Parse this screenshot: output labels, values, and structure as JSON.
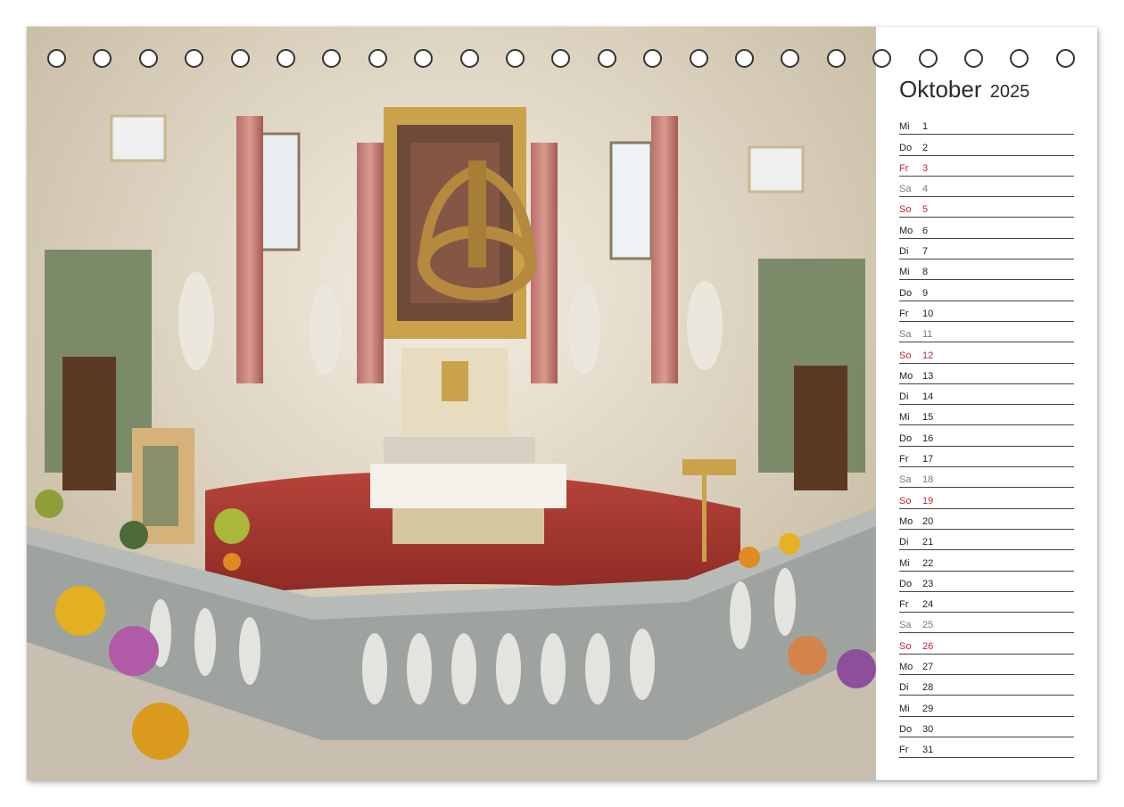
{
  "calendar": {
    "month": "Oktober",
    "year": "2025",
    "days": [
      {
        "wd": "Mi",
        "d": "1",
        "type": "wk"
      },
      {
        "wd": "Do",
        "d": "2",
        "type": "wk"
      },
      {
        "wd": "Fr",
        "d": "3",
        "type": "hol"
      },
      {
        "wd": "Sa",
        "d": "4",
        "type": "sat"
      },
      {
        "wd": "So",
        "d": "5",
        "type": "sun"
      },
      {
        "wd": "Mo",
        "d": "6",
        "type": "wk"
      },
      {
        "wd": "Di",
        "d": "7",
        "type": "wk"
      },
      {
        "wd": "Mi",
        "d": "8",
        "type": "wk"
      },
      {
        "wd": "Do",
        "d": "9",
        "type": "wk"
      },
      {
        "wd": "Fr",
        "d": "10",
        "type": "wk"
      },
      {
        "wd": "Sa",
        "d": "11",
        "type": "sat"
      },
      {
        "wd": "So",
        "d": "12",
        "type": "sun"
      },
      {
        "wd": "Mo",
        "d": "13",
        "type": "wk"
      },
      {
        "wd": "Di",
        "d": "14",
        "type": "wk"
      },
      {
        "wd": "Mi",
        "d": "15",
        "type": "wk"
      },
      {
        "wd": "Do",
        "d": "16",
        "type": "wk"
      },
      {
        "wd": "Fr",
        "d": "17",
        "type": "wk"
      },
      {
        "wd": "Sa",
        "d": "18",
        "type": "sat"
      },
      {
        "wd": "So",
        "d": "19",
        "type": "sun"
      },
      {
        "wd": "Mo",
        "d": "20",
        "type": "wk"
      },
      {
        "wd": "Di",
        "d": "21",
        "type": "wk"
      },
      {
        "wd": "Mi",
        "d": "22",
        "type": "wk"
      },
      {
        "wd": "Do",
        "d": "23",
        "type": "wk"
      },
      {
        "wd": "Fr",
        "d": "24",
        "type": "wk"
      },
      {
        "wd": "Sa",
        "d": "25",
        "type": "sat"
      },
      {
        "wd": "So",
        "d": "26",
        "type": "sun"
      },
      {
        "wd": "Mo",
        "d": "27",
        "type": "wk"
      },
      {
        "wd": "Di",
        "d": "28",
        "type": "wk"
      },
      {
        "wd": "Mi",
        "d": "29",
        "type": "wk"
      },
      {
        "wd": "Do",
        "d": "30",
        "type": "wk"
      },
      {
        "wd": "Fr",
        "d": "31",
        "type": "wk"
      }
    ]
  },
  "colors": {
    "holiday_red": "#c0272d",
    "saturday_grey": "#7a7a7a",
    "carpet_red": "#a8322c",
    "gold": "#c9a24a"
  },
  "binding": {
    "hole_count": 23
  }
}
